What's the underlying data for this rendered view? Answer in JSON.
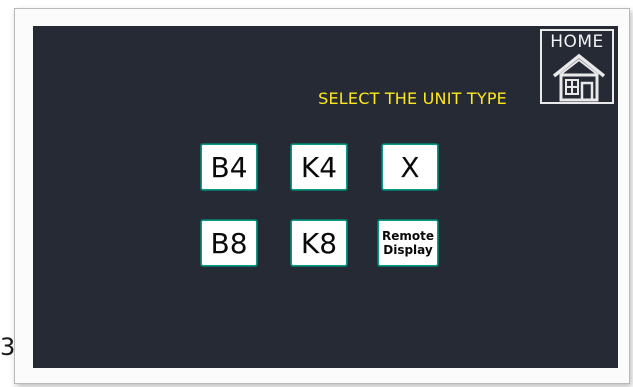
{
  "edge_char": "3",
  "home": {
    "label": "HOME",
    "icon": "house-icon"
  },
  "title": "SELECT THE UNIT TYPE",
  "units": [
    {
      "id": "b4",
      "label": "B4"
    },
    {
      "id": "k4",
      "label": "K4"
    },
    {
      "id": "x",
      "label": "X"
    },
    {
      "id": "b8",
      "label": "B8"
    },
    {
      "id": "k8",
      "label": "K8"
    },
    {
      "id": "remote-display",
      "label_line1": "Remote",
      "label_line2": "Display"
    }
  ],
  "colors": {
    "screen_bg": "#262a35",
    "title": "#ffe81c",
    "button_border": "#0b9a86",
    "home_stroke": "#e9e9e9"
  }
}
